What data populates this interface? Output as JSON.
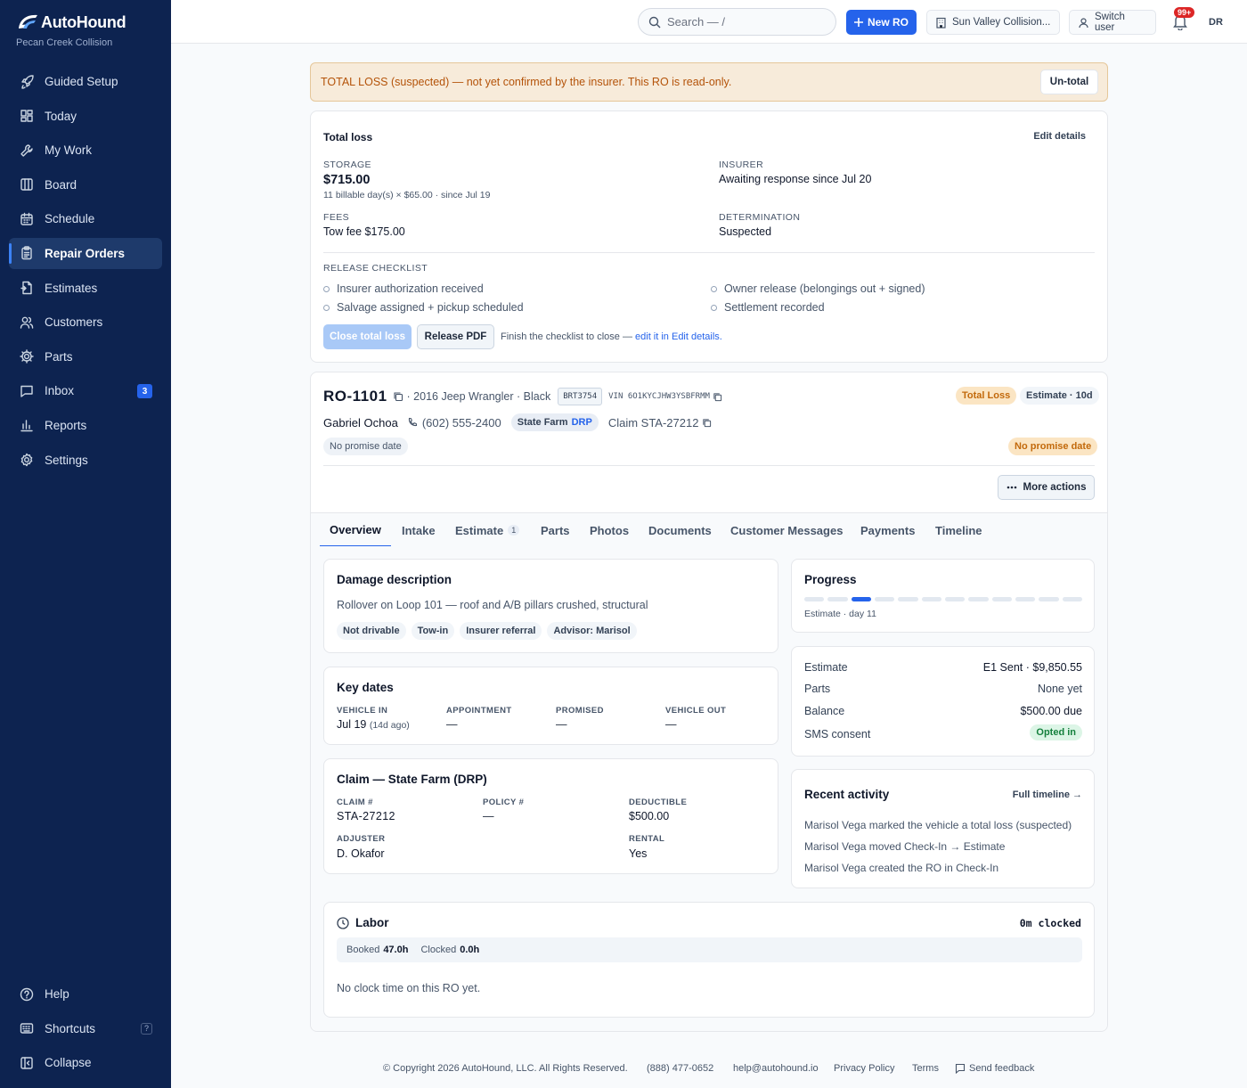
{
  "brand": {
    "name": "AutoHound",
    "shop": "Pecan Creek Collision"
  },
  "nav": {
    "items": [
      {
        "label": "Guided Setup",
        "icon": "rocket-icon"
      },
      {
        "label": "Today",
        "icon": "grid-icon"
      },
      {
        "label": "My Work",
        "icon": "wrench-icon"
      },
      {
        "label": "Board",
        "icon": "columns-icon"
      },
      {
        "label": "Schedule",
        "icon": "calendar-icon"
      },
      {
        "label": "Repair Orders",
        "icon": "clipboard-icon"
      },
      {
        "label": "Estimates",
        "icon": "file-icon"
      },
      {
        "label": "Customers",
        "icon": "users-icon"
      },
      {
        "label": "Parts",
        "icon": "gear-icon"
      },
      {
        "label": "Inbox",
        "icon": "message-icon",
        "badge": "3"
      },
      {
        "label": "Reports",
        "icon": "bar-chart-icon"
      },
      {
        "label": "Settings",
        "icon": "settings-icon"
      }
    ],
    "active": "Repair Orders",
    "bottom": [
      {
        "label": "Help",
        "icon": "help-icon"
      },
      {
        "label": "Shortcuts",
        "icon": "keyboard-icon",
        "kbd": "?"
      },
      {
        "label": "Collapse",
        "icon": "collapse-icon"
      }
    ]
  },
  "topbar": {
    "search_placeholder": "Search — /",
    "new_ro": "New RO",
    "location": "Sun Valley Collision...",
    "switch_user": "Switch user",
    "notifications": "99+",
    "avatar": "DR"
  },
  "banner": {
    "text": "TOTAL LOSS (suspected) — not yet confirmed by the insurer. This RO is read-only.",
    "button": "Un-total"
  },
  "total_loss": {
    "title": "Total loss",
    "edit": "Edit details",
    "storage_label": "STORAGE",
    "storage_amount": "$715.00",
    "storage_detail": "11 billable day(s) × $65.00 · since Jul 19",
    "insurer_label": "INSURER",
    "insurer_value": "Awaiting response since Jul 20",
    "fees_label": "FEES",
    "fees_value": "Tow fee $175.00",
    "determination_label": "DETERMINATION",
    "determination_value": "Suspected",
    "checklist_label": "RELEASE CHECKLIST",
    "checklist": [
      "Insurer authorization received",
      "Owner release (belongings out + signed)",
      "Salvage assigned + pickup scheduled",
      "Settlement recorded"
    ],
    "close_btn": "Close total loss",
    "pdf_btn": "Release PDF",
    "hint": "Finish the checklist to close —",
    "hint_link": "edit it in Edit details."
  },
  "ro": {
    "number": "RO-1101",
    "vehicle": "· 2016 Jeep Wrangler · Black",
    "plate": "BRT3754",
    "vin": "VIN 6O1KYCJHW3YSBFRMM",
    "status_badge": "Total Loss",
    "stage_badge": "Estimate · 10d",
    "customer": "Gabriel Ochoa",
    "phone": "(602) 555-2400",
    "insurer": "State Farm",
    "drp": "DRP",
    "claim": "Claim STA-27212",
    "promise_left": "No promise date",
    "promise_right": "No promise date",
    "more_actions": "More actions"
  },
  "tabs": [
    {
      "label": "Overview"
    },
    {
      "label": "Intake"
    },
    {
      "label": "Estimate",
      "count": "1"
    },
    {
      "label": "Parts"
    },
    {
      "label": "Photos"
    },
    {
      "label": "Documents"
    },
    {
      "label": "Customer Messages"
    },
    {
      "label": "Payments"
    },
    {
      "label": "Timeline"
    }
  ],
  "damage": {
    "title": "Damage description",
    "text": "Rollover on Loop 101 — roof and A/B pillars crushed, structural",
    "tags": [
      "Not drivable",
      "Tow-in",
      "Insurer referral",
      "Advisor: Marisol"
    ]
  },
  "key_dates": {
    "title": "Key dates",
    "vehicle_in_label": "VEHICLE IN",
    "vehicle_in": "Jul 19",
    "vehicle_in_ago": "(14d ago)",
    "appointment_label": "APPOINTMENT",
    "appointment": "—",
    "promised_label": "PROMISED",
    "promised": "—",
    "vehicle_out_label": "VEHICLE OUT",
    "vehicle_out": "—"
  },
  "claim": {
    "title": "Claim — State Farm (DRP)",
    "claim_label": "CLAIM #",
    "claim": "STA-27212",
    "policy_label": "POLICY #",
    "policy": "—",
    "deductible_label": "DEDUCTIBLE",
    "deductible": "$500.00",
    "adjuster_label": "ADJUSTER",
    "adjuster": "D. Okafor",
    "rental_label": "RENTAL",
    "rental": "Yes"
  },
  "progress": {
    "title": "Progress",
    "caption": "Estimate · day 11",
    "total_steps": 12,
    "current_step": 3,
    "active_color": "#2563eb",
    "inactive_color": "#e2e8f0"
  },
  "summary": {
    "estimate_label": "Estimate",
    "estimate_value": "E1 Sent · $9,850.55",
    "parts_label": "Parts",
    "parts_value": "None yet",
    "balance_label": "Balance",
    "balance_value": "$500.00 due",
    "sms_label": "SMS consent",
    "sms_value": "Opted in"
  },
  "activity": {
    "title": "Recent activity",
    "link": "Full timeline →",
    "items": [
      "Marisol Vega marked the vehicle a total loss (suspected)",
      "Marisol Vega moved Check-In → Estimate",
      "Marisol Vega created the RO in Check-In"
    ]
  },
  "labor": {
    "title": "Labor",
    "clocked": "0m clocked",
    "booked_label": "Booked",
    "booked": "47.0h",
    "clocked_label": "Clocked",
    "clocked_value": "0.0h",
    "empty": "No clock time on this RO yet."
  },
  "footer": {
    "copyright": "© Copyright 2026 AutoHound, LLC. All Rights Reserved.",
    "phone": "(888) 477-0652",
    "email": "help@autohound.io",
    "privacy": "Privacy Policy",
    "terms": "Terms",
    "feedback": "Send feedback"
  }
}
